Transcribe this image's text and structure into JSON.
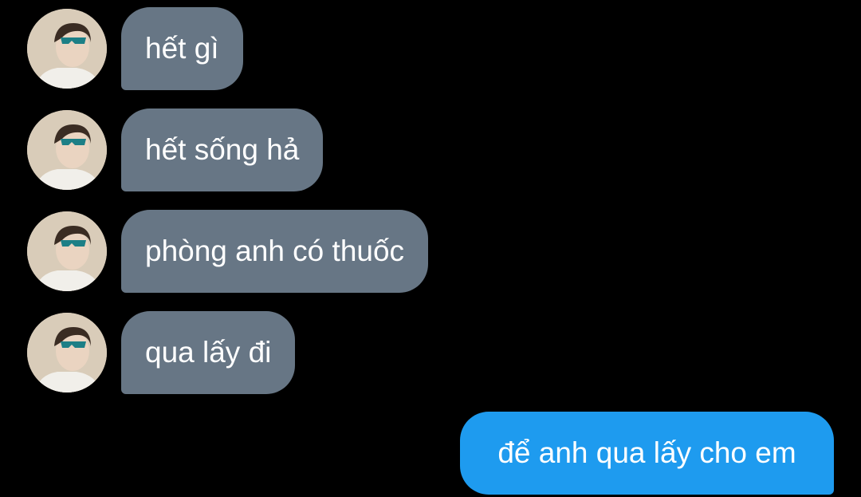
{
  "colors": {
    "background": "#000000",
    "incoming_bubble": "#677685",
    "outgoing_bubble": "#1e9bef",
    "text": "#ffffff"
  },
  "messages": [
    {
      "direction": "incoming",
      "avatar": "user-avatar",
      "text": "hết gì"
    },
    {
      "direction": "incoming",
      "avatar": "user-avatar",
      "text": "hết sống hả"
    },
    {
      "direction": "incoming",
      "avatar": "user-avatar",
      "text": "phòng anh có thuốc"
    },
    {
      "direction": "incoming",
      "avatar": "user-avatar",
      "text": "qua lấy đi"
    },
    {
      "direction": "outgoing",
      "text": "để anh qua lấy cho em"
    }
  ]
}
